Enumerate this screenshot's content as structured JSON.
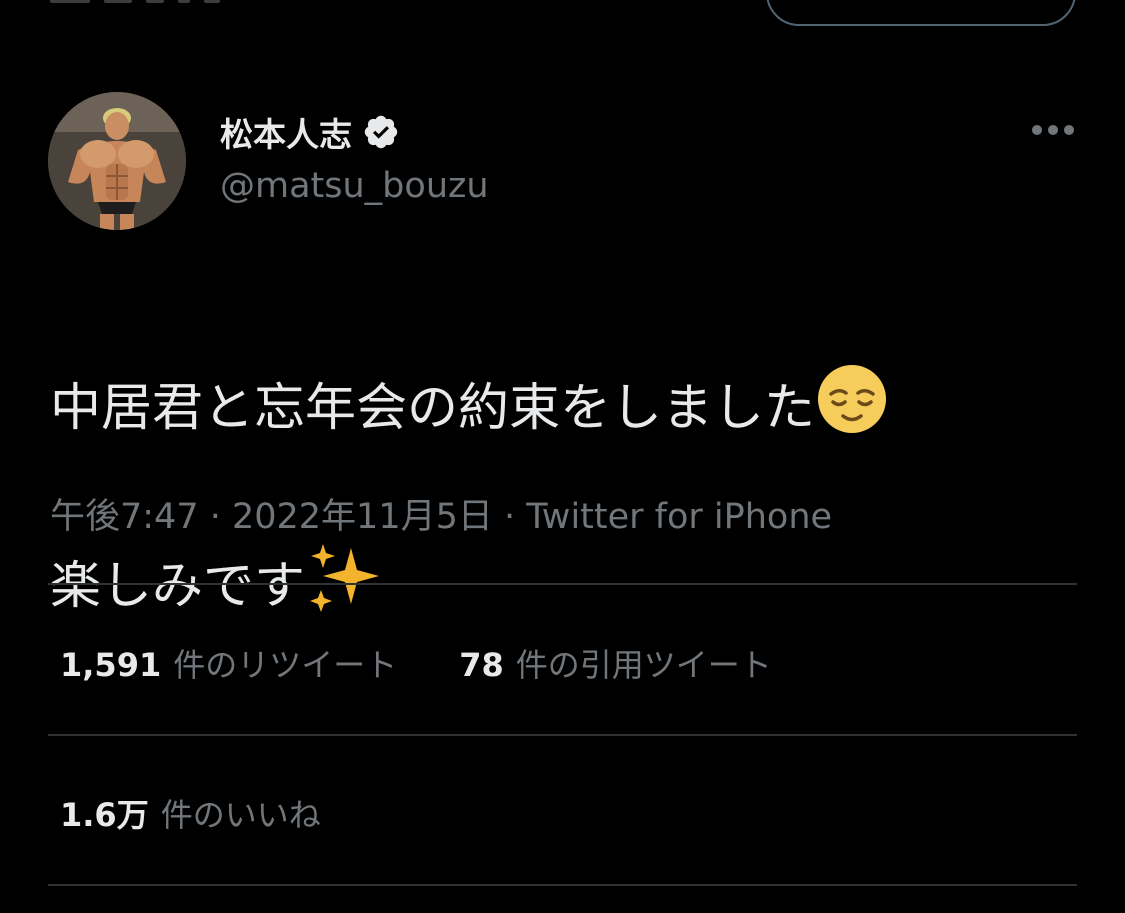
{
  "tweet": {
    "author_name": "松本人志",
    "author_handle": "@matsu_bouzu",
    "text_line1": "中居君と忘年会の約束をしました",
    "text_line2": "楽しみです",
    "meta": "午後7:47 · 2022年11月5日 · Twitter for iPhone"
  },
  "stats": {
    "retweets_value": "1,591",
    "retweets_label": "件のリツイート",
    "quotes_value": "78",
    "quotes_label": "件の引用ツイート",
    "likes_value": "1.6万",
    "likes_label": "件のいいね"
  },
  "icons": {
    "verified": "verified-badge-icon",
    "more": "more-horizontal-icon",
    "emoji1": "relieved-face-emoji",
    "emoji2": "sparkles-emoji"
  },
  "colors": {
    "background": "#000000",
    "primary_text": "#e7e9ea",
    "secondary_text": "#71767b",
    "divider": "#2f3336"
  }
}
